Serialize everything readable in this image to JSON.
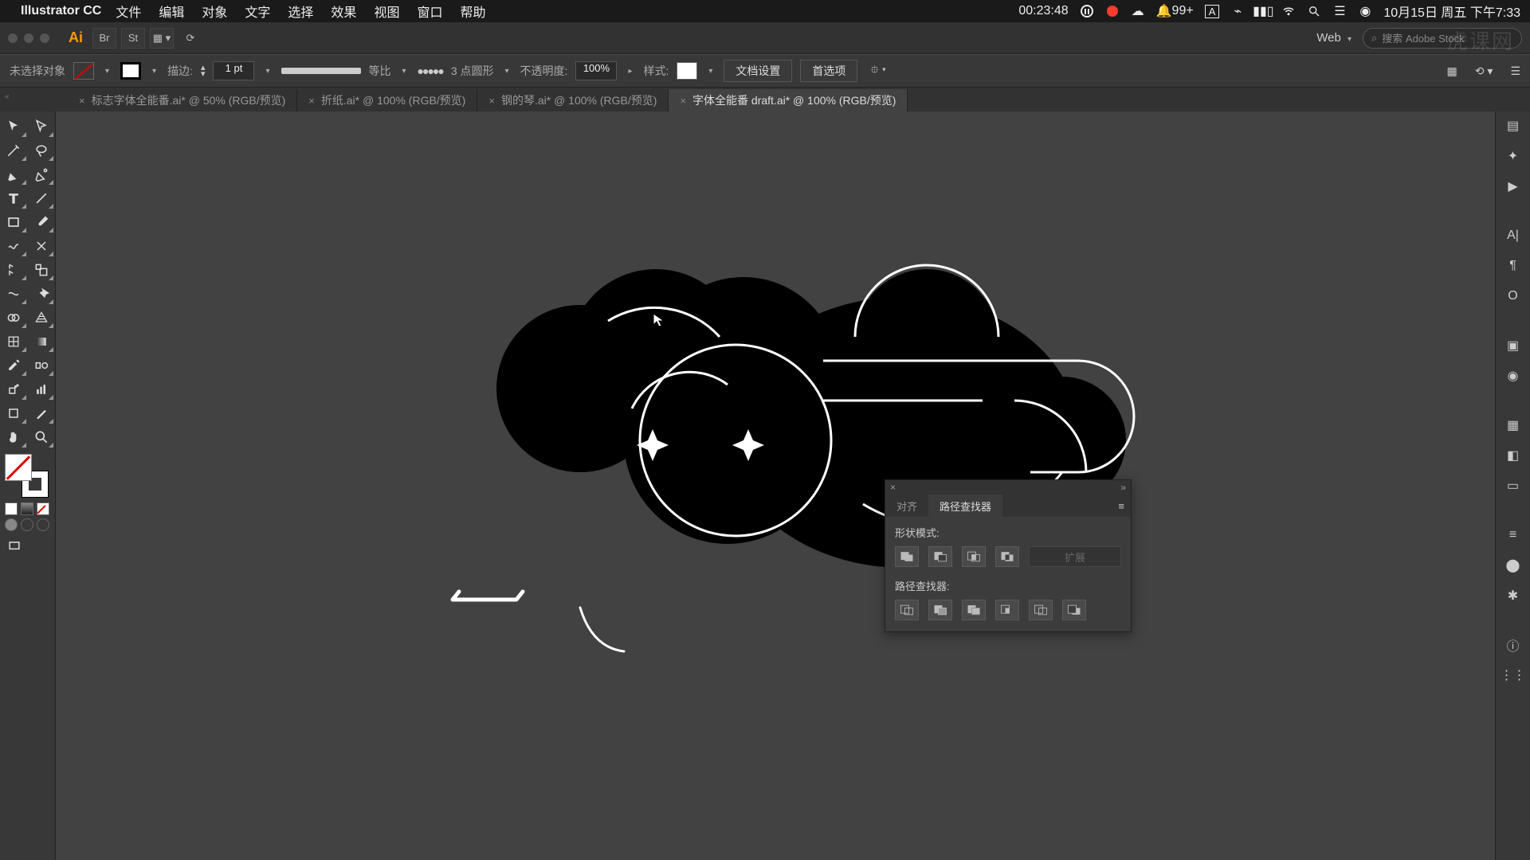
{
  "menubar": {
    "app": "Illustrator CC",
    "items": [
      "文件",
      "编辑",
      "对象",
      "文字",
      "选择",
      "效果",
      "视图",
      "窗口",
      "帮助"
    ],
    "timer": "00:23:48",
    "notif": "99+",
    "input_badge": "A",
    "date": "10月15日 周五 下午7:33"
  },
  "header": {
    "profile": "Web",
    "search_placeholder": "搜索 Adobe Stock",
    "watermark": "虎课网"
  },
  "control": {
    "selection": "未选择对象",
    "stroke_label": "描边:",
    "stroke_weight": "1 pt",
    "profile_label": "等比",
    "brush_label": "3 点圆形",
    "opacity_label": "不透明度:",
    "opacity_value": "100%",
    "style_label": "样式:",
    "doc_setup": "文档设置",
    "prefs": "首选项"
  },
  "tabs": [
    {
      "label": "标志字体全能番.ai* @ 50% (RGB/预览)",
      "active": false
    },
    {
      "label": "折纸.ai* @ 100% (RGB/预览)",
      "active": false
    },
    {
      "label": "钢的琴.ai* @ 100% (RGB/预览)",
      "active": false
    },
    {
      "label": "字体全能番 draft.ai* @ 100% (RGB/预览)",
      "active": true
    }
  ],
  "panel": {
    "tabs": [
      "对齐",
      "路径查找器"
    ],
    "active_tab": "路径查找器",
    "shape_modes": "形状模式:",
    "expand": "扩展",
    "pathfinders": "路径查找器:"
  }
}
